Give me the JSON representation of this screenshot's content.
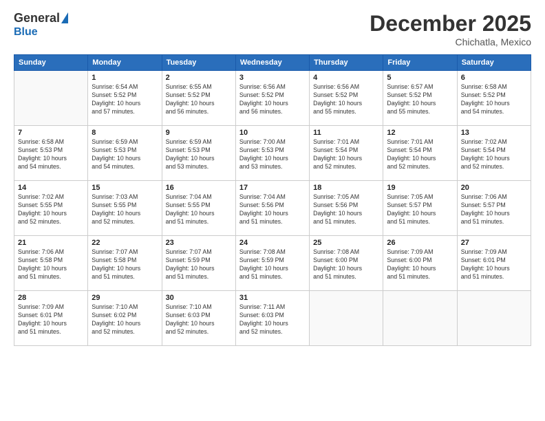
{
  "logo": {
    "general": "General",
    "blue": "Blue"
  },
  "title": "December 2025",
  "location": "Chichatla, Mexico",
  "days_header": [
    "Sunday",
    "Monday",
    "Tuesday",
    "Wednesday",
    "Thursday",
    "Friday",
    "Saturday"
  ],
  "weeks": [
    [
      {
        "num": "",
        "info": ""
      },
      {
        "num": "1",
        "info": "Sunrise: 6:54 AM\nSunset: 5:52 PM\nDaylight: 10 hours\nand 57 minutes."
      },
      {
        "num": "2",
        "info": "Sunrise: 6:55 AM\nSunset: 5:52 PM\nDaylight: 10 hours\nand 56 minutes."
      },
      {
        "num": "3",
        "info": "Sunrise: 6:56 AM\nSunset: 5:52 PM\nDaylight: 10 hours\nand 56 minutes."
      },
      {
        "num": "4",
        "info": "Sunrise: 6:56 AM\nSunset: 5:52 PM\nDaylight: 10 hours\nand 55 minutes."
      },
      {
        "num": "5",
        "info": "Sunrise: 6:57 AM\nSunset: 5:52 PM\nDaylight: 10 hours\nand 55 minutes."
      },
      {
        "num": "6",
        "info": "Sunrise: 6:58 AM\nSunset: 5:52 PM\nDaylight: 10 hours\nand 54 minutes."
      }
    ],
    [
      {
        "num": "7",
        "info": "Sunrise: 6:58 AM\nSunset: 5:53 PM\nDaylight: 10 hours\nand 54 minutes."
      },
      {
        "num": "8",
        "info": "Sunrise: 6:59 AM\nSunset: 5:53 PM\nDaylight: 10 hours\nand 54 minutes."
      },
      {
        "num": "9",
        "info": "Sunrise: 6:59 AM\nSunset: 5:53 PM\nDaylight: 10 hours\nand 53 minutes."
      },
      {
        "num": "10",
        "info": "Sunrise: 7:00 AM\nSunset: 5:53 PM\nDaylight: 10 hours\nand 53 minutes."
      },
      {
        "num": "11",
        "info": "Sunrise: 7:01 AM\nSunset: 5:54 PM\nDaylight: 10 hours\nand 52 minutes."
      },
      {
        "num": "12",
        "info": "Sunrise: 7:01 AM\nSunset: 5:54 PM\nDaylight: 10 hours\nand 52 minutes."
      },
      {
        "num": "13",
        "info": "Sunrise: 7:02 AM\nSunset: 5:54 PM\nDaylight: 10 hours\nand 52 minutes."
      }
    ],
    [
      {
        "num": "14",
        "info": "Sunrise: 7:02 AM\nSunset: 5:55 PM\nDaylight: 10 hours\nand 52 minutes."
      },
      {
        "num": "15",
        "info": "Sunrise: 7:03 AM\nSunset: 5:55 PM\nDaylight: 10 hours\nand 52 minutes."
      },
      {
        "num": "16",
        "info": "Sunrise: 7:04 AM\nSunset: 5:55 PM\nDaylight: 10 hours\nand 51 minutes."
      },
      {
        "num": "17",
        "info": "Sunrise: 7:04 AM\nSunset: 5:56 PM\nDaylight: 10 hours\nand 51 minutes."
      },
      {
        "num": "18",
        "info": "Sunrise: 7:05 AM\nSunset: 5:56 PM\nDaylight: 10 hours\nand 51 minutes."
      },
      {
        "num": "19",
        "info": "Sunrise: 7:05 AM\nSunset: 5:57 PM\nDaylight: 10 hours\nand 51 minutes."
      },
      {
        "num": "20",
        "info": "Sunrise: 7:06 AM\nSunset: 5:57 PM\nDaylight: 10 hours\nand 51 minutes."
      }
    ],
    [
      {
        "num": "21",
        "info": "Sunrise: 7:06 AM\nSunset: 5:58 PM\nDaylight: 10 hours\nand 51 minutes."
      },
      {
        "num": "22",
        "info": "Sunrise: 7:07 AM\nSunset: 5:58 PM\nDaylight: 10 hours\nand 51 minutes."
      },
      {
        "num": "23",
        "info": "Sunrise: 7:07 AM\nSunset: 5:59 PM\nDaylight: 10 hours\nand 51 minutes."
      },
      {
        "num": "24",
        "info": "Sunrise: 7:08 AM\nSunset: 5:59 PM\nDaylight: 10 hours\nand 51 minutes."
      },
      {
        "num": "25",
        "info": "Sunrise: 7:08 AM\nSunset: 6:00 PM\nDaylight: 10 hours\nand 51 minutes."
      },
      {
        "num": "26",
        "info": "Sunrise: 7:09 AM\nSunset: 6:00 PM\nDaylight: 10 hours\nand 51 minutes."
      },
      {
        "num": "27",
        "info": "Sunrise: 7:09 AM\nSunset: 6:01 PM\nDaylight: 10 hours\nand 51 minutes."
      }
    ],
    [
      {
        "num": "28",
        "info": "Sunrise: 7:09 AM\nSunset: 6:01 PM\nDaylight: 10 hours\nand 51 minutes."
      },
      {
        "num": "29",
        "info": "Sunrise: 7:10 AM\nSunset: 6:02 PM\nDaylight: 10 hours\nand 52 minutes."
      },
      {
        "num": "30",
        "info": "Sunrise: 7:10 AM\nSunset: 6:03 PM\nDaylight: 10 hours\nand 52 minutes."
      },
      {
        "num": "31",
        "info": "Sunrise: 7:11 AM\nSunset: 6:03 PM\nDaylight: 10 hours\nand 52 minutes."
      },
      {
        "num": "",
        "info": ""
      },
      {
        "num": "",
        "info": ""
      },
      {
        "num": "",
        "info": ""
      }
    ]
  ]
}
